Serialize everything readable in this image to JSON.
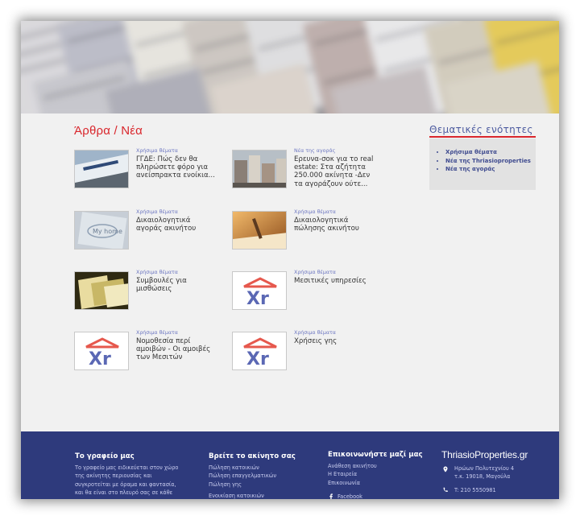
{
  "content": {
    "section_title": "Άρθρα / Νέα",
    "articles": [
      {
        "category": "Χρήσιμα θέματα",
        "title": "ΓΓΔΕ: Πώς δεν θα πληρώσετε φόρο για ανείσπρακτα ενοίκια..."
      },
      {
        "category": "Νέα της αγοράς",
        "title": "Ερευνα-σοκ για το real estate: Στα αζήτητα 250.000 ακίνητα -Δεν τα αγοράζουν ούτε..."
      },
      {
        "category": "Χρήσιμα θέματα",
        "title": "Δικαιολογητικά αγοράς ακινήτου"
      },
      {
        "category": "Χρήσιμα θέματα",
        "title": "Δικαιολογητικά πώλησης ακινήτου"
      },
      {
        "category": "Χρήσιμα θέματα",
        "title": "Συμβουλές για μισθώσεις"
      },
      {
        "category": "Χρήσιμα θέματα",
        "title": "Μεσιτικές υπηρεσίες"
      },
      {
        "category": "Χρήσιμα θέματα",
        "title": "Νομοθεσία περί αμοιβών - Οι αμοιβές των Μεσιτών"
      },
      {
        "category": "Χρήσιμα θέματα",
        "title": "Χρήσεις γης"
      }
    ]
  },
  "sidebar": {
    "title": "Θεματικές ενότητες",
    "items": [
      "Χρήσιμα θέματα",
      "Νέα της Thriasioproperties",
      "Νέα της αγοράς"
    ]
  },
  "footer": {
    "office": {
      "title": "Το γραφείο μας",
      "text": [
        "Το γραφείο μας ειδικεύεται στον χώρο",
        "της ακίνητης περιουσίας και",
        "συγκροτείται με όραμα και φαντασία,",
        "και θα είναι στο πλευρό σας σε κάθε"
      ]
    },
    "find": {
      "title": "Βρείτε το ακίνητο σας",
      "links": [
        "Πώληση κατοικιών",
        "Πώληση επαγγελματικών",
        "Πώληση γης",
        "Ενοικίαση κατοικιών"
      ]
    },
    "contact": {
      "title": "Επικοινωνήστε μαζί μας",
      "links": [
        "Ανάθεση ακινήτου",
        "Η Εταιρεία",
        "Επικοινωνία"
      ],
      "facebook": "Facebook"
    },
    "brand": {
      "name": "ThriasioProperties.gr",
      "address_line1": "Ηρώων Πολυτεχνίου 4",
      "address_line2": "τ.κ. 19018, Μαγούλα",
      "phone": "T: 210 5550981"
    }
  },
  "colors": {
    "accent_red": "#d9262c",
    "link_blue": "#6d77c1",
    "footer_bg": "#2e3a7c"
  }
}
